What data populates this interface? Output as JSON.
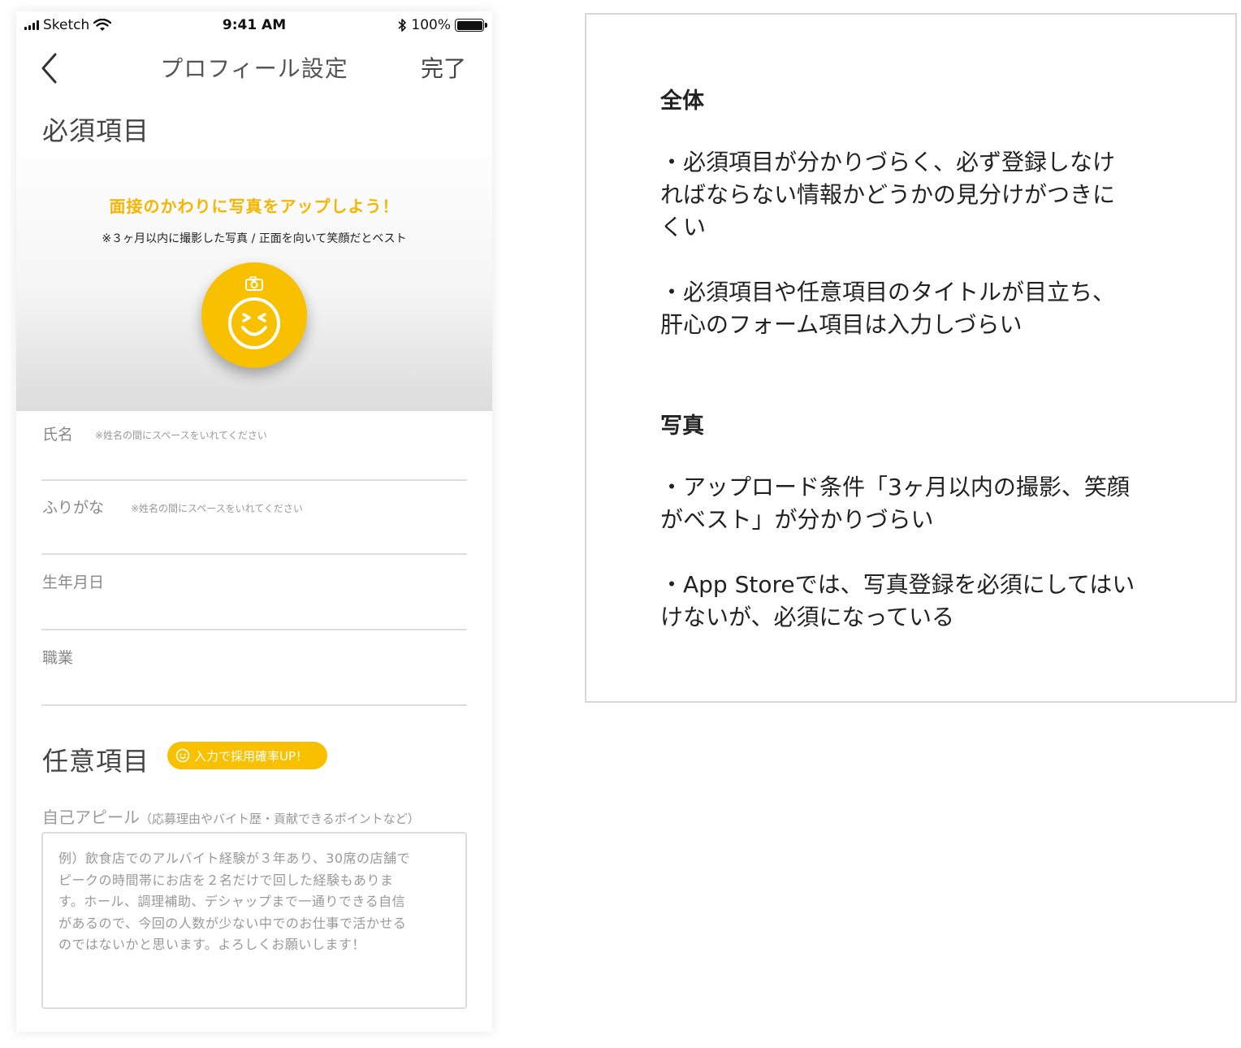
{
  "status_bar": {
    "carrier": "Sketch",
    "time": "9:41 AM",
    "battery": "100%",
    "battery_level": 1.0
  },
  "nav": {
    "back_icon": "chevron-left-icon",
    "title": "プロフィール設定",
    "done_label": "完了"
  },
  "required": {
    "title": "必須項目",
    "photo": {
      "headline": "面接のかわりに写真をアップしよう！",
      "note": "※３ヶ月以内に撮影した写真 / 正面を向いて笑顔だとベスト",
      "button_icon": "camera-smile-icon",
      "accent_color": "#f9c000"
    },
    "fields": [
      {
        "label": "氏名",
        "hint": "※姓名の間にスペースをいれてください"
      },
      {
        "label": "ふりがな",
        "hint": "※姓名の間にスペースをいれてください"
      },
      {
        "label": "生年月日",
        "hint": ""
      },
      {
        "label": "職業",
        "hint": ""
      }
    ]
  },
  "optional": {
    "title": "任意項目",
    "badge": "入力で採用確率UP！",
    "appeal_label": "自己アピール",
    "appeal_sub": "（応募理由やバイト歴・貢献できるポイントなど）",
    "appeal_placeholder_lines": [
      "例）飲食店でのアルバイト経験が３年あり、30席の店舗で",
      "ピークの時間帯にお店を２名だけで回した経験もありま",
      "す。ホール、調理補助、デシャップまで一通りできる自信",
      "があるので、今回の人数が少ない中でのお仕事で活かせる",
      "のではないかと思います。よろしくお願いします！"
    ]
  },
  "notes": {
    "sections": [
      {
        "heading": "全体",
        "items": [
          [
            "・必須項目が分かりづらく、必ず登録しなけ",
            "ればならない情報かどうかの見分けがつきに",
            "くい"
          ],
          [
            "・必須項目や任意項目のタイトルが目立ち、",
            "肝心のフォーム項目は入力しづらい"
          ]
        ]
      },
      {
        "heading": "写真",
        "items": [
          [
            "・アップロード条件「3ヶ月以内の撮影、笑顔",
            "がベスト」が分かりづらい"
          ],
          [
            "・App Storeでは、写真登録を必須にしてはい",
            "けないが、必須になっている"
          ]
        ]
      }
    ]
  }
}
